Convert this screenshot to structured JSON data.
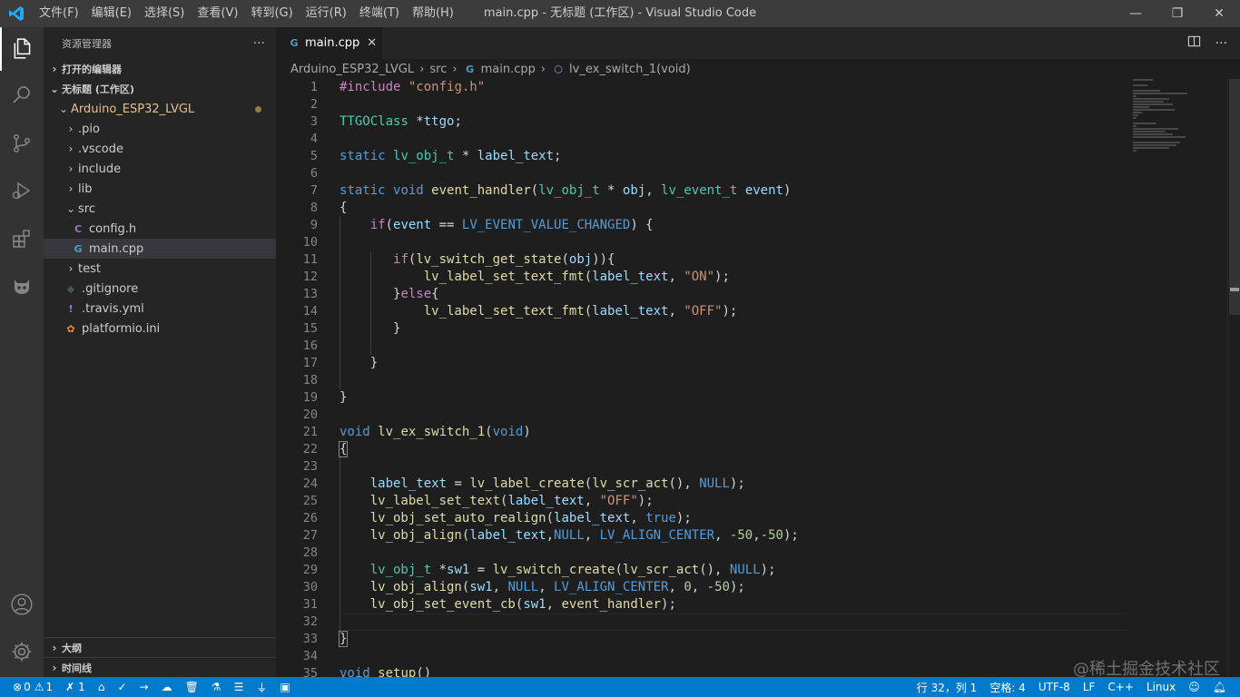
{
  "window": {
    "title": "main.cpp - 无标题 (工作区) - Visual Studio Code",
    "menu": [
      "文件(F)",
      "编辑(E)",
      "选择(S)",
      "查看(V)",
      "转到(G)",
      "运行(R)",
      "终端(T)",
      "帮助(H)"
    ],
    "controls": {
      "minimize": "—",
      "restore": "❐",
      "close": "✕"
    }
  },
  "activity": {
    "icons": [
      "files-icon",
      "search-icon",
      "source-control-icon",
      "run-debug-icon",
      "extensions-icon",
      "platformio-icon",
      "account-icon",
      "settings-gear-icon"
    ]
  },
  "sidebar": {
    "header": "资源管理器",
    "more": "···",
    "open_editors": "打开的编辑器",
    "workspace": "无标题 (工作区)",
    "root_folder": "Arduino_ESP32_LVGL",
    "items": [
      {
        "label": ".pio",
        "type": "folder"
      },
      {
        "label": ".vscode",
        "type": "folder"
      },
      {
        "label": "include",
        "type": "folder"
      },
      {
        "label": "lib",
        "type": "folder"
      },
      {
        "label": "src",
        "type": "folder-open"
      },
      {
        "label": "config.h",
        "type": "c-header"
      },
      {
        "label": "main.cpp",
        "type": "cpp"
      },
      {
        "label": "test",
        "type": "folder"
      },
      {
        "label": ".gitignore",
        "type": "git"
      },
      {
        "label": ".travis.yml",
        "type": "yaml"
      },
      {
        "label": "platformio.ini",
        "type": "ini"
      }
    ],
    "outline": "大纲",
    "timeline": "时间线"
  },
  "tabs": [
    {
      "label": "main.cpp",
      "active": true
    }
  ],
  "breadcrumb": [
    "Arduino_ESP32_LVGL",
    "src",
    "main.cpp",
    "lv_ex_switch_1(void)"
  ],
  "editor": {
    "line_numbers": [
      "1",
      "2",
      "3",
      "4",
      "5",
      "6",
      "7",
      "8",
      "9",
      "10",
      "11",
      "12",
      "13",
      "14",
      "15",
      "16",
      "17",
      "18",
      "19",
      "20",
      "21",
      "22",
      "23",
      "24",
      "25",
      "26",
      "27",
      "28",
      "29",
      "30",
      "31",
      "32",
      "33",
      "34",
      "35"
    ],
    "cursor_line": 32
  },
  "statusbar": {
    "errors": "0",
    "warnings": "1",
    "tasks": "1",
    "position": "行 32，列 1",
    "spaces": "空格: 4",
    "encoding": "UTF-8",
    "eol": "LF",
    "language": "C++",
    "platform": "Linux"
  },
  "watermark": "@稀土掘金技术社区",
  "colors": {
    "statusbar": "#007acc",
    "sidebar": "#252526",
    "editor": "#1e1e1e",
    "activitybar": "#333333",
    "titlebar": "#3c3c3c"
  }
}
